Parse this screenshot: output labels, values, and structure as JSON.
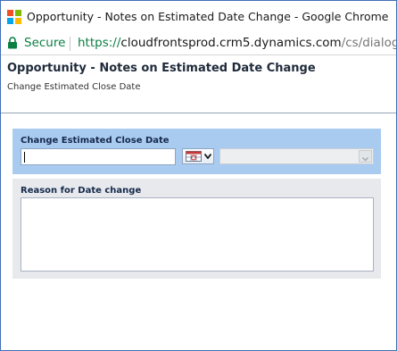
{
  "browser": {
    "window_title": "Opportunity - Notes on Estimated Date Change - Google Chrome",
    "secure_label": "Secure",
    "url_scheme": "https://",
    "url_host": "cloudfrontsprod.crm5.dynamics.com",
    "url_path": "/cs/dialog/run"
  },
  "dialog": {
    "title": "Opportunity - Notes on Estimated Date Change",
    "subtitle": "Change Estimated Close Date"
  },
  "form": {
    "close_date_label": "Change Estimated Close Date",
    "close_date_value": "",
    "time_value": "",
    "reason_label": "Reason for Date change",
    "reason_value": ""
  },
  "icons": {
    "windows_logo": "windows-logo-icon",
    "lock": "lock-icon",
    "calendar": "calendar-icon",
    "dropdown": "chevron-down-icon"
  },
  "colors": {
    "secure_green": "#0b8043",
    "section_blue": "#a9cbf0",
    "section_grey": "#e7e9ed",
    "window_border": "#3f6fb5"
  }
}
